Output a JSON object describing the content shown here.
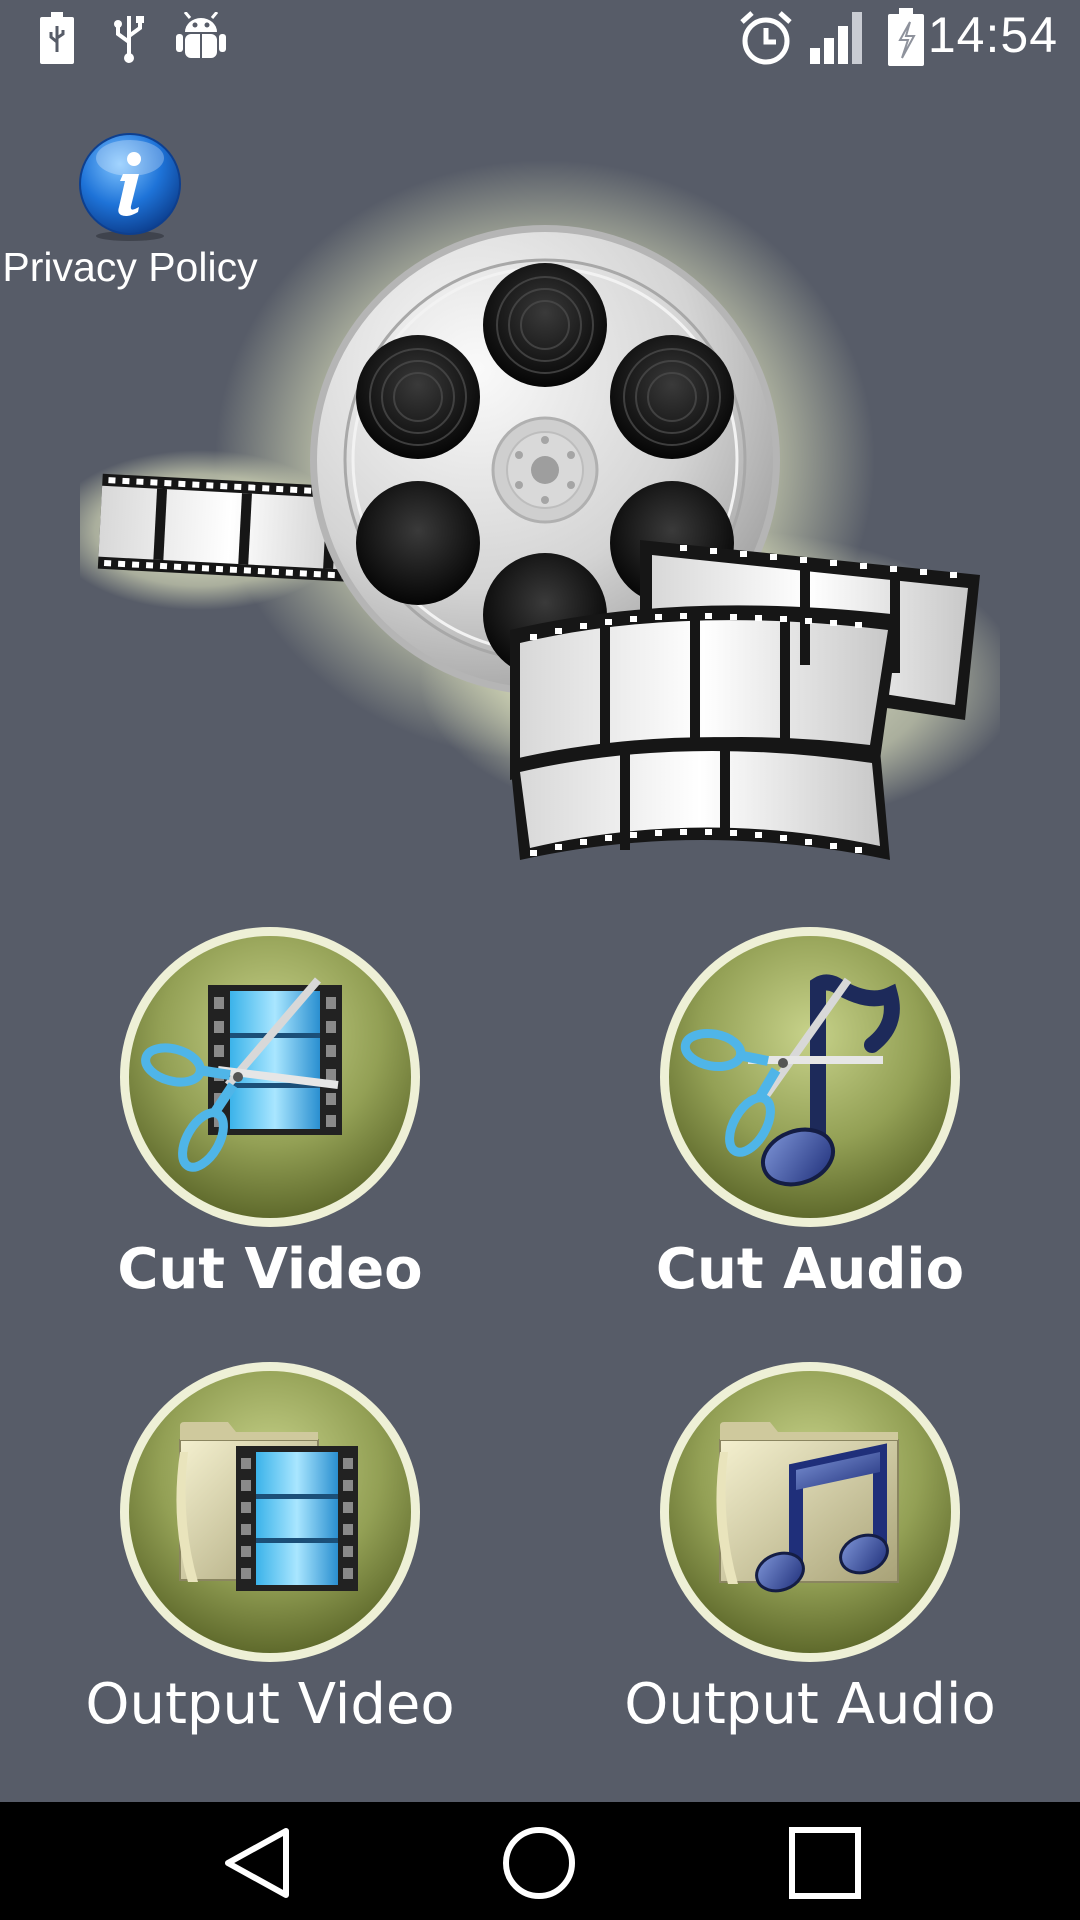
{
  "status_bar": {
    "time": "14:54",
    "left_icons": [
      "battery-usb-icon",
      "usb-icon",
      "android-debug-icon"
    ],
    "right_icons": [
      "alarm-icon",
      "signal-icon",
      "battery-charging-icon"
    ]
  },
  "privacy": {
    "label": "Privacy Policy",
    "icon": "info-icon"
  },
  "hero": {
    "icon": "film-reel-icon"
  },
  "tiles": [
    {
      "label": "Cut Video",
      "icon": "cut-video-icon"
    },
    {
      "label": "Cut Audio",
      "icon": "cut-audio-icon"
    },
    {
      "label": "Output Video",
      "icon": "output-video-folder-icon"
    },
    {
      "label": "Output Audio",
      "icon": "output-audio-folder-icon"
    }
  ],
  "nav_bar": {
    "buttons": [
      "back-icon",
      "home-icon",
      "recents-icon"
    ]
  },
  "colors": {
    "background": "#575c68",
    "tile_green": "#8d9a52",
    "tile_ring": "#f2f4dc",
    "nav_bar": "#000000"
  }
}
